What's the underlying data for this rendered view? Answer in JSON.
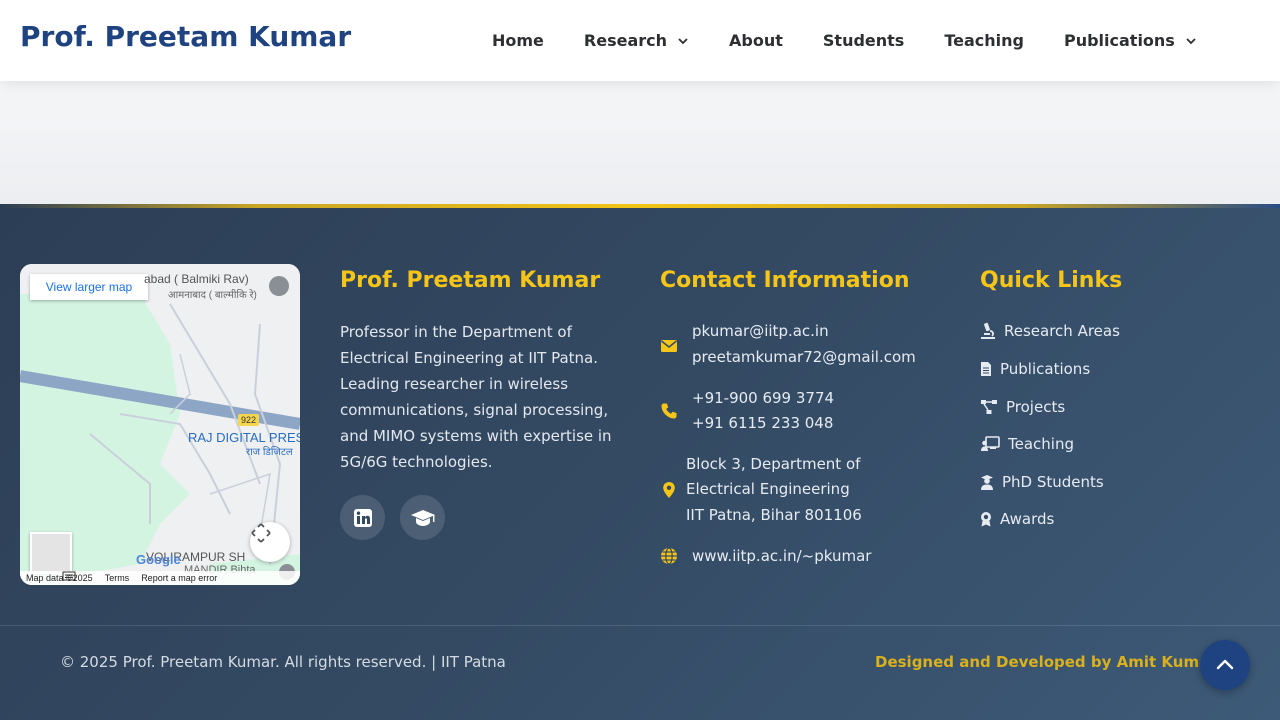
{
  "header": {
    "brand": "Prof. Preetam Kumar",
    "nav": [
      {
        "label": "Home",
        "has_dropdown": false
      },
      {
        "label": "Research",
        "has_dropdown": true
      },
      {
        "label": "About",
        "has_dropdown": false
      },
      {
        "label": "Students",
        "has_dropdown": false
      },
      {
        "label": "Teaching",
        "has_dropdown": false
      },
      {
        "label": "Publications",
        "has_dropdown": true
      }
    ]
  },
  "map": {
    "button": "View larger map",
    "label_top": "abad ( Balmiki Rav)",
    "label_top_hindi": "आमनाबाद ( बाल्मीकि रे)",
    "road_badge": "922",
    "place": "RAJ DIGITAL PRES",
    "place_hindi": "राज डिजिटल",
    "place_bottom": "VOLIRAMPUR SH",
    "place_bottom2": "MANDIR Bihta",
    "attribution": "Google",
    "footer_items": [
      "Map data ©2025",
      "Terms",
      "Report a map error"
    ]
  },
  "about": {
    "title": "Prof. Preetam Kumar",
    "text": "Professor in the Department of Electrical Engineering at IIT Patna. Leading researcher in wireless communications, signal processing, and MIMO systems with expertise in 5G/6G technologies.",
    "social": [
      {
        "icon": "linkedin-icon"
      },
      {
        "icon": "graduation-cap-icon"
      }
    ]
  },
  "contact": {
    "title": "Contact Information",
    "email_1": "pkumar@iitp.ac.in",
    "email_2": "preetamkumar72@gmail.com",
    "phone_1": "+91-900 699 3774",
    "phone_2": "+91 6115 233 048",
    "address_1": "Block 3, Department of",
    "address_2": "Electrical Engineering",
    "address_3": "IIT Patna, Bihar 801106",
    "website": "www.iitp.ac.in/~pkumar"
  },
  "quick_links": {
    "title": "Quick Links",
    "items": [
      {
        "label": "Research Areas",
        "icon": "microscope-icon"
      },
      {
        "label": "Publications",
        "icon": "document-icon"
      },
      {
        "label": "Projects",
        "icon": "project-diagram-icon"
      },
      {
        "label": "Teaching",
        "icon": "teacher-icon"
      },
      {
        "label": "PhD Students",
        "icon": "student-icon"
      },
      {
        "label": "Awards",
        "icon": "award-icon"
      }
    ]
  },
  "footer": {
    "copyright": "© 2025 Prof. Preetam Kumar. All rights reserved. | IIT Patna",
    "credit": "Designed and Developed by Amit Kumar"
  },
  "colors": {
    "brand_blue": "#1f4380",
    "accent_gold": "#f5c518",
    "footer_bg": "#344a63"
  }
}
